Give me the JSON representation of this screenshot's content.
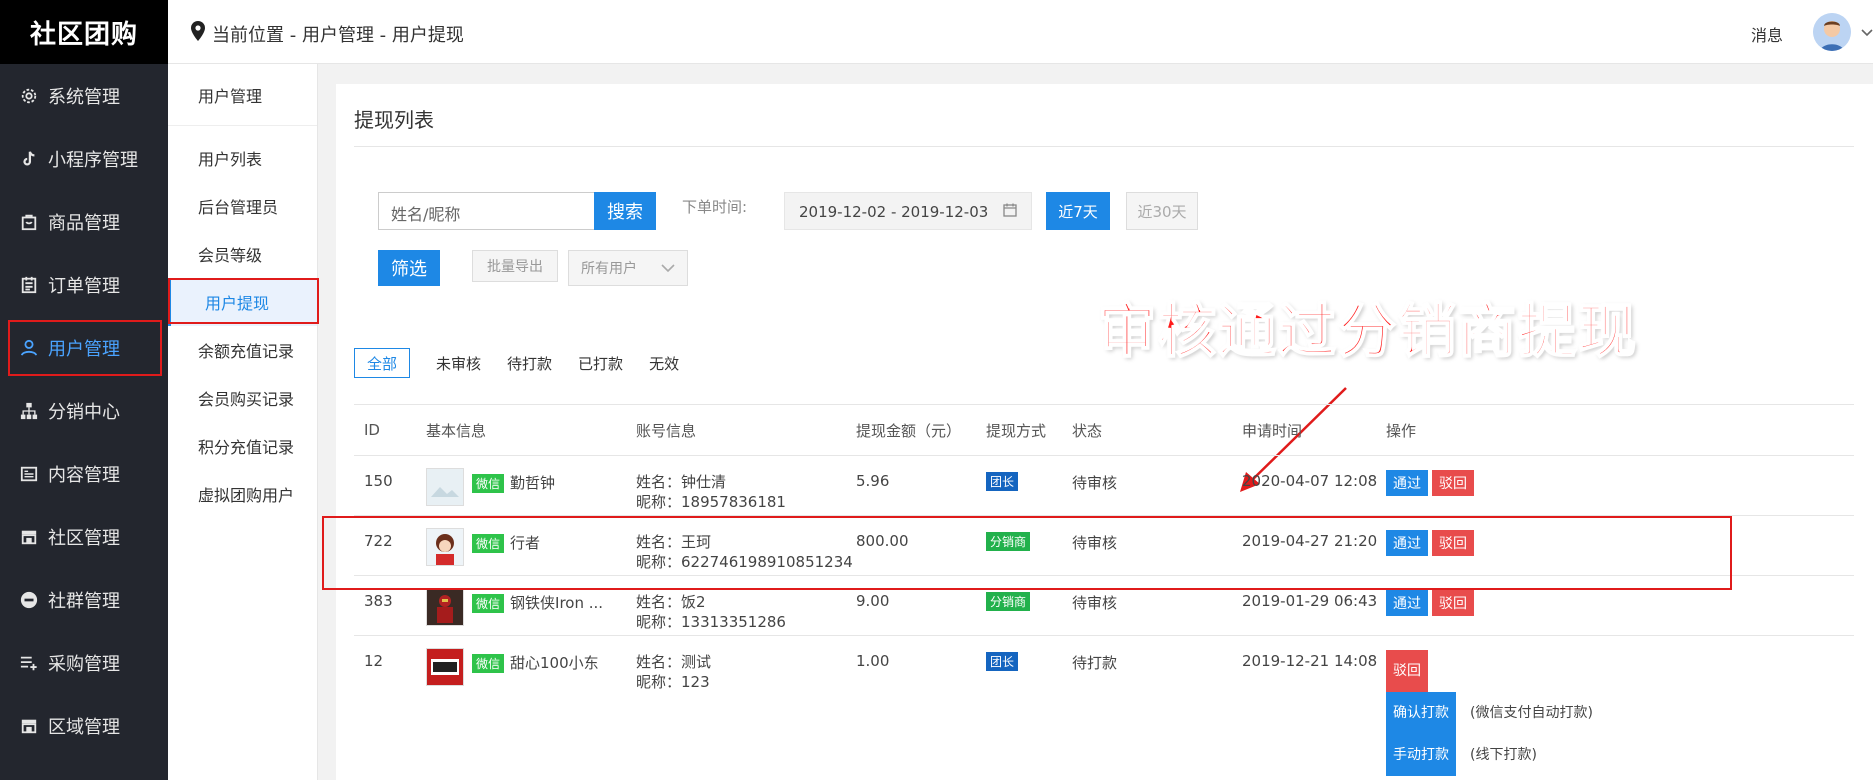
{
  "brand": "社区团购",
  "sidebar": {
    "items": [
      {
        "label": "系统管理",
        "icon": "gear-icon"
      },
      {
        "label": "小程序管理",
        "icon": "tiktok-icon"
      },
      {
        "label": "商品管理",
        "icon": "bag-icon"
      },
      {
        "label": "订单管理",
        "icon": "clipboard-icon"
      },
      {
        "label": "用户管理",
        "icon": "user-icon"
      },
      {
        "label": "分销中心",
        "icon": "hierarchy-icon"
      },
      {
        "label": "内容管理",
        "icon": "article-icon"
      },
      {
        "label": "社区管理",
        "icon": "store-icon"
      },
      {
        "label": "社群管理",
        "icon": "minus-circle-icon"
      },
      {
        "label": "采购管理",
        "icon": "list-add-icon"
      },
      {
        "label": "区域管理",
        "icon": "store-icon"
      }
    ]
  },
  "header": {
    "breadcrumb": "当前位置 - 用户管理 - 用户提现",
    "message": "消息"
  },
  "submenu": {
    "title": "用户管理",
    "items": [
      "用户列表",
      "后台管理员",
      "会员等级",
      "用户提现",
      "余额充值记录",
      "会员购买记录",
      "积分充值记录",
      "虚拟团购用户"
    ]
  },
  "main": {
    "title": "提现列表",
    "search_placeholder": "姓名/昵称",
    "search_button": "搜索",
    "time_label": "下单时间:",
    "date_range": "2019-12-02 - 2019-12-03",
    "btn_7": "近7天",
    "btn_30": "近30天",
    "btn_filter": "筛选",
    "btn_export": "批量导出",
    "user_select": "所有用户",
    "annotation": "审核通过分销商提现",
    "tabs": [
      "全部",
      "未审核",
      "待打款",
      "已打款",
      "无效"
    ]
  },
  "table": {
    "headers": [
      "ID",
      "基本信息",
      "账号信息",
      "提现金额（元）",
      "提现方式",
      "状态",
      "申请时间",
      "操作"
    ],
    "wechat_tag": "微信",
    "rows": [
      {
        "id": "150",
        "name": "勤哲钟",
        "account_name": "姓名：钟仕清",
        "account_nick": "昵称：18957836181",
        "amount": "5.96",
        "way": "团长",
        "status": "待审核",
        "time": "2020-04-07 12:08",
        "op1": "通过",
        "op2": "驳回"
      },
      {
        "id": "722",
        "name": "行者",
        "account_name": "姓名：王珂",
        "account_nick": "昵称：622746198910851234",
        "amount": "800.00",
        "way": "分销商",
        "status": "待审核",
        "time": "2019-04-27 21:20",
        "op1": "通过",
        "op2": "驳回"
      },
      {
        "id": "383",
        "name": "钢铁侠Iron ...",
        "account_name": "姓名：饭2",
        "account_nick": "昵称：13313351286",
        "amount": "9.00",
        "way": "分销商",
        "status": "待审核",
        "time": "2019-01-29 06:43",
        "op1": "通过",
        "op2": "驳回"
      },
      {
        "id": "12",
        "name": "甜心100小东",
        "account_name": "姓名：测试",
        "account_nick": "昵称：123",
        "amount": "1.00",
        "way": "团长",
        "status": "待打款",
        "time": "2019-12-21 14:08",
        "op_reject": "驳回",
        "op_confirm": "确认打款",
        "op_confirm_note": "(微信支付自动打款)",
        "op_manual": "手动打款",
        "op_manual_note": "(线下打款)"
      }
    ]
  },
  "colors": {
    "accent": "#1e88e5",
    "danger": "#e84c4c",
    "wechat": "#2ec34a",
    "annotation": "#ff1a1a"
  }
}
